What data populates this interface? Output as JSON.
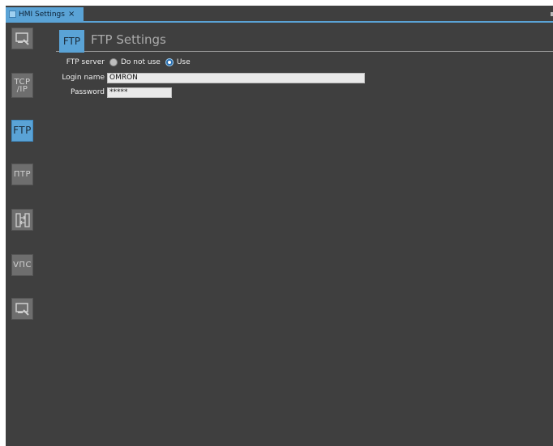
{
  "tab": {
    "label": "HMI Settings",
    "close": "×"
  },
  "sidebar": {
    "items": [
      {
        "name": "general",
        "text": ""
      },
      {
        "name": "tcpip",
        "text_line1": "TCP",
        "text_line2": "/IP"
      },
      {
        "name": "ftp",
        "text": "FTP"
      },
      {
        "name": "ntp",
        "text": "ΠTP"
      },
      {
        "name": "transfer",
        "text": ""
      },
      {
        "name": "vnc",
        "text": "VПC"
      },
      {
        "name": "other",
        "text": ""
      }
    ]
  },
  "header": {
    "icon_text": "FTP",
    "title": "FTP Settings"
  },
  "form": {
    "ftp_server_label": "FTP server",
    "option_do_not_use": "Do not use",
    "option_use": "Use",
    "selected": "Use",
    "login_label": "Login name",
    "login_value": "OMRON",
    "password_label": "Password",
    "password_value": "*****"
  },
  "colors": {
    "accent": "#5aa3d6",
    "background": "#3f3f3f"
  }
}
